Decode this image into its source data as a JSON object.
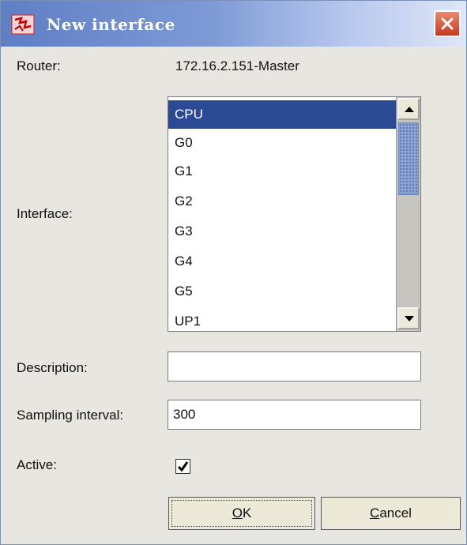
{
  "window": {
    "title": "New interface",
    "icon": "app-logo-icon",
    "close_icon": "close-icon"
  },
  "router": {
    "label": "Router:",
    "value": "172.16.2.151-Master"
  },
  "interface": {
    "label": "Interface:",
    "items": [
      "CPU",
      "G0",
      "G1",
      "G2",
      "G3",
      "G4",
      "G5",
      "UP1"
    ],
    "selected": "CPU"
  },
  "description": {
    "label": "Description:",
    "value": ""
  },
  "sampling": {
    "label": "Sampling interval:",
    "value": "300"
  },
  "active": {
    "label": "Active:",
    "checked": true
  },
  "buttons": {
    "ok_mnemonic": "O",
    "ok_rest": "K",
    "cancel_mnemonic": "C",
    "cancel_rest": "ancel"
  },
  "colors": {
    "selection": "#2c4a93",
    "title_gradient_start": "#5f7fc4",
    "close_button": "#c6381f"
  }
}
